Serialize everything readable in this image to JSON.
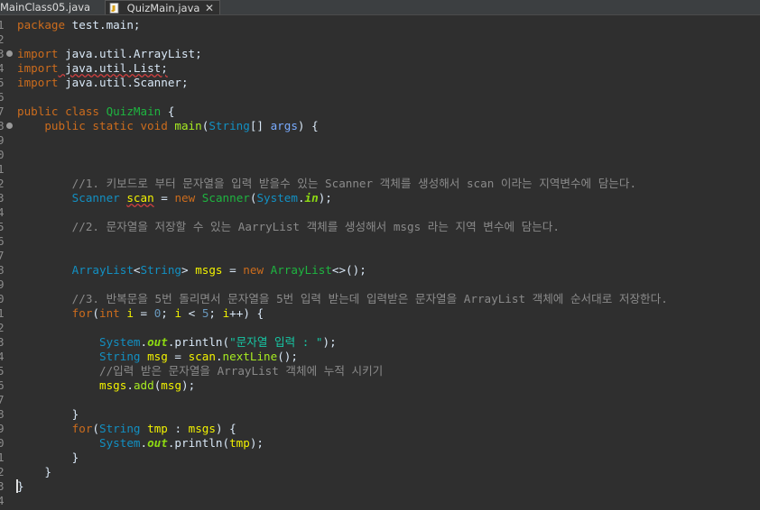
{
  "tabs": [
    {
      "label": "MainClass05.java",
      "active": false
    },
    {
      "label": "QuizMain.java",
      "active": true
    }
  ],
  "editor": {
    "lines": [
      {
        "n": "1",
        "tokens": [
          {
            "t": "package",
            "c": "kw"
          },
          {
            "t": " test.main;",
            "c": "plain"
          }
        ]
      },
      {
        "n": "2",
        "tokens": []
      },
      {
        "n": "3",
        "fold": true,
        "tokens": [
          {
            "t": "import",
            "c": "kw"
          },
          {
            "t": " java.util.ArrayList;",
            "c": "plain"
          }
        ]
      },
      {
        "n": "4",
        "tokens": [
          {
            "t": "import",
            "c": "kw"
          },
          {
            "t": " java.util.List;",
            "c": "plain squig"
          }
        ]
      },
      {
        "n": "5",
        "tokens": [
          {
            "t": "import",
            "c": "kw"
          },
          {
            "t": " java.util.Scanner;",
            "c": "plain"
          }
        ]
      },
      {
        "n": "6",
        "tokens": []
      },
      {
        "n": "7",
        "tokens": [
          {
            "t": "public class ",
            "c": "kw"
          },
          {
            "t": "QuizMain",
            "c": "cls"
          },
          {
            "t": " {",
            "c": "plain"
          }
        ]
      },
      {
        "n": "8",
        "fold": true,
        "tokens": [
          {
            "t": "    public static void ",
            "c": "kw"
          },
          {
            "t": "main",
            "c": "fn"
          },
          {
            "t": "(",
            "c": "plain"
          },
          {
            "t": "String",
            "c": "type"
          },
          {
            "t": "[] ",
            "c": "plain"
          },
          {
            "t": "args",
            "c": "param"
          },
          {
            "t": ") {",
            "c": "plain"
          }
        ]
      },
      {
        "n": "9",
        "tokens": []
      },
      {
        "n": "0",
        "tokens": []
      },
      {
        "n": "1",
        "tokens": []
      },
      {
        "n": "2",
        "tokens": [
          {
            "t": "        //1. 키보드로 부터 문자열을 입력 받을수 있는 Scanner 객체를 생성해서 scan 이라는 지역변수에 담는다.",
            "c": "cmt"
          }
        ]
      },
      {
        "n": "3",
        "tokens": [
          {
            "t": "        ",
            "c": "plain"
          },
          {
            "t": "Scanner",
            "c": "type"
          },
          {
            "t": " ",
            "c": "plain"
          },
          {
            "t": "scan",
            "c": "var squig"
          },
          {
            "t": " = ",
            "c": "plain"
          },
          {
            "t": "new ",
            "c": "kw"
          },
          {
            "t": "Scanner",
            "c": "cls"
          },
          {
            "t": "(",
            "c": "plain"
          },
          {
            "t": "System",
            "c": "type"
          },
          {
            "t": ".",
            "c": "plain"
          },
          {
            "t": "in",
            "c": "field"
          },
          {
            "t": ");",
            "c": "plain"
          }
        ]
      },
      {
        "n": "4",
        "tokens": []
      },
      {
        "n": "5",
        "tokens": [
          {
            "t": "        //2. 문자열을 저장할 수 있는 AarryList 객체를 생성해서 msgs 라는 지역 변수에 담는다.",
            "c": "cmt"
          }
        ]
      },
      {
        "n": "6",
        "tokens": []
      },
      {
        "n": "7",
        "tokens": []
      },
      {
        "n": "8",
        "tokens": [
          {
            "t": "        ",
            "c": "plain"
          },
          {
            "t": "ArrayList",
            "c": "type"
          },
          {
            "t": "<",
            "c": "plain"
          },
          {
            "t": "String",
            "c": "type"
          },
          {
            "t": "> ",
            "c": "plain"
          },
          {
            "t": "msgs",
            "c": "var"
          },
          {
            "t": " = ",
            "c": "plain"
          },
          {
            "t": "new ",
            "c": "kw"
          },
          {
            "t": "ArrayList",
            "c": "cls"
          },
          {
            "t": "<>();",
            "c": "plain"
          }
        ]
      },
      {
        "n": "9",
        "tokens": []
      },
      {
        "n": "0",
        "tokens": [
          {
            "t": "        //3. 반복문을 5번 돌리면서 문자열을 5번 입력 받는데 입력받은 문자열을 ArrayList 객체에 순서대로 저장한다.",
            "c": "cmt"
          }
        ]
      },
      {
        "n": "1",
        "tokens": [
          {
            "t": "        ",
            "c": "plain"
          },
          {
            "t": "for",
            "c": "kw"
          },
          {
            "t": "(",
            "c": "plain"
          },
          {
            "t": "int ",
            "c": "kw"
          },
          {
            "t": "i",
            "c": "var"
          },
          {
            "t": " = ",
            "c": "plain"
          },
          {
            "t": "0",
            "c": "num"
          },
          {
            "t": "; ",
            "c": "plain"
          },
          {
            "t": "i",
            "c": "var"
          },
          {
            "t": " < ",
            "c": "plain"
          },
          {
            "t": "5",
            "c": "num"
          },
          {
            "t": "; ",
            "c": "plain"
          },
          {
            "t": "i",
            "c": "var"
          },
          {
            "t": "++) {",
            "c": "plain"
          }
        ]
      },
      {
        "n": "2",
        "tokens": []
      },
      {
        "n": "3",
        "tokens": [
          {
            "t": "            ",
            "c": "plain"
          },
          {
            "t": "System",
            "c": "type"
          },
          {
            "t": ".",
            "c": "plain"
          },
          {
            "t": "out",
            "c": "field"
          },
          {
            "t": ".println(",
            "c": "plain"
          },
          {
            "t": "\"문자열 입력 : \"",
            "c": "str"
          },
          {
            "t": ");",
            "c": "plain"
          }
        ]
      },
      {
        "n": "4",
        "tokens": [
          {
            "t": "            ",
            "c": "plain"
          },
          {
            "t": "String",
            "c": "type"
          },
          {
            "t": " ",
            "c": "plain"
          },
          {
            "t": "msg",
            "c": "var"
          },
          {
            "t": " = ",
            "c": "plain"
          },
          {
            "t": "scan",
            "c": "var"
          },
          {
            "t": ".",
            "c": "plain"
          },
          {
            "t": "nextLine",
            "c": "fn"
          },
          {
            "t": "();",
            "c": "plain"
          }
        ]
      },
      {
        "n": "5",
        "tokens": [
          {
            "t": "            //입력 받은 문자열을 ArrayList 객체에 누적 시키기",
            "c": "cmt"
          }
        ]
      },
      {
        "n": "6",
        "tokens": [
          {
            "t": "            ",
            "c": "plain"
          },
          {
            "t": "msgs",
            "c": "var"
          },
          {
            "t": ".",
            "c": "plain"
          },
          {
            "t": "add",
            "c": "fn"
          },
          {
            "t": "(",
            "c": "plain"
          },
          {
            "t": "msg",
            "c": "var"
          },
          {
            "t": ");",
            "c": "plain"
          }
        ]
      },
      {
        "n": "7",
        "tokens": []
      },
      {
        "n": "8",
        "tokens": [
          {
            "t": "        }",
            "c": "plain"
          }
        ]
      },
      {
        "n": "9",
        "tokens": [
          {
            "t": "        ",
            "c": "plain"
          },
          {
            "t": "for",
            "c": "kw"
          },
          {
            "t": "(",
            "c": "plain"
          },
          {
            "t": "String",
            "c": "type"
          },
          {
            "t": " ",
            "c": "plain"
          },
          {
            "t": "tmp",
            "c": "var"
          },
          {
            "t": " : ",
            "c": "plain"
          },
          {
            "t": "msgs",
            "c": "var"
          },
          {
            "t": ") {",
            "c": "plain"
          }
        ]
      },
      {
        "n": "0",
        "tokens": [
          {
            "t": "            ",
            "c": "plain"
          },
          {
            "t": "System",
            "c": "type"
          },
          {
            "t": ".",
            "c": "plain"
          },
          {
            "t": "out",
            "c": "field"
          },
          {
            "t": ".println(",
            "c": "plain"
          },
          {
            "t": "tmp",
            "c": "var"
          },
          {
            "t": ");",
            "c": "plain"
          }
        ]
      },
      {
        "n": "1",
        "tokens": [
          {
            "t": "        }",
            "c": "plain"
          }
        ]
      },
      {
        "n": "2",
        "tokens": [
          {
            "t": "    }",
            "c": "plain"
          }
        ]
      },
      {
        "n": "3",
        "tokens": [
          {
            "t": "}",
            "c": "plain"
          }
        ]
      },
      {
        "n": "4",
        "tokens": []
      }
    ]
  }
}
